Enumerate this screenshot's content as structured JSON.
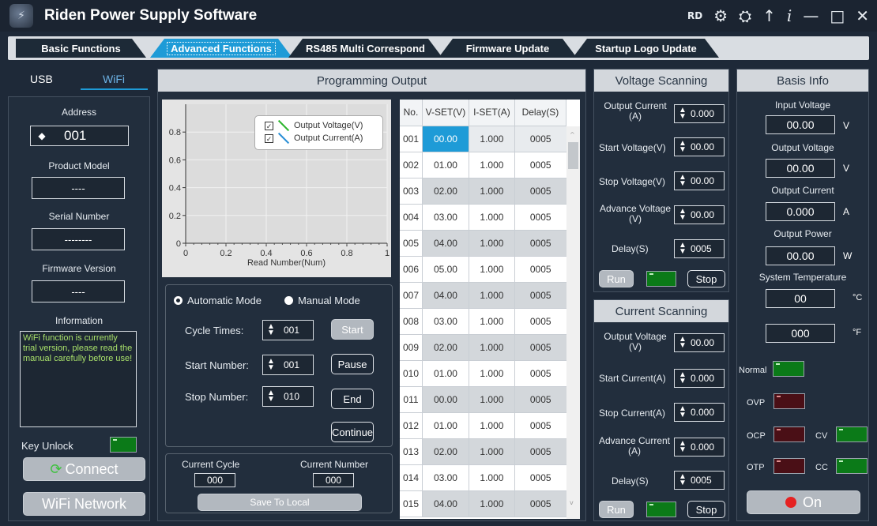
{
  "app": {
    "title": "Riden Power Supply Software",
    "rd": "RD"
  },
  "tabs": [
    "Basic Functions",
    "Advanced Functions",
    "RS485 Multi Correspond",
    "Firmware Update",
    "Startup Logo Update"
  ],
  "left": {
    "usb": "USB",
    "wifi": "WiFi",
    "address_label": "Address",
    "address": "001",
    "model_label": "Product Model",
    "model": "----",
    "serial_label": "Serial Number",
    "serial": "--------",
    "fw_label": "Firmware Version",
    "fw": "----",
    "info_label": "Information",
    "info": "WiFi function is currently trial version, please read the manual carefully before use!",
    "key_unlock": "Key Unlock",
    "connect": "Connect",
    "wifi_network": "WiFi Network"
  },
  "prog": {
    "title": "Programming Output",
    "legend_v": "Output Voltage(V)",
    "legend_c": "Output Current(A)",
    "auto": "Automatic Mode",
    "manual": "Manual Mode",
    "cycle_label": "Cycle Times:",
    "cycle": "001",
    "start_label": "Start Number:",
    "start": "001",
    "stop_label": "Stop Number:",
    "stop": "010",
    "btn_start": "Start",
    "btn_pause": "Pause",
    "btn_end": "End",
    "btn_continue": "Continue",
    "cur_cycle_label": "Current Cycle",
    "cur_cycle": "000",
    "cur_num_label": "Current Number",
    "cur_num": "000",
    "save": "Save To Local"
  },
  "chart_data": {
    "type": "line",
    "xlabel": "Read Number(Num)",
    "ylabel": "",
    "xlim": [
      0,
      1
    ],
    "ylim": [
      0,
      1
    ],
    "xticks": [
      "0",
      "0.2",
      "0.4",
      "0.6",
      "0.8",
      "1"
    ],
    "yticks": [
      "0",
      "0.2",
      "0.4",
      "0.6",
      "0.8"
    ],
    "series": [
      {
        "name": "Output Voltage(V)",
        "values": []
      },
      {
        "name": "Output Current(A)",
        "values": []
      }
    ],
    "grid": true,
    "legend": "top-right"
  },
  "table": {
    "headers": [
      "No.",
      "V-SET(V)",
      "I-SET(A)",
      "Delay(S)"
    ],
    "rows": [
      [
        "001",
        "00.00",
        "1.000",
        "0005"
      ],
      [
        "002",
        "01.00",
        "1.000",
        "0005"
      ],
      [
        "003",
        "02.00",
        "1.000",
        "0005"
      ],
      [
        "004",
        "03.00",
        "1.000",
        "0005"
      ],
      [
        "005",
        "04.00",
        "1.000",
        "0005"
      ],
      [
        "006",
        "05.00",
        "1.000",
        "0005"
      ],
      [
        "007",
        "04.00",
        "1.000",
        "0005"
      ],
      [
        "008",
        "03.00",
        "1.000",
        "0005"
      ],
      [
        "009",
        "02.00",
        "1.000",
        "0005"
      ],
      [
        "010",
        "01.00",
        "1.000",
        "0005"
      ],
      [
        "011",
        "00.00",
        "1.000",
        "0005"
      ],
      [
        "012",
        "01.00",
        "1.000",
        "0005"
      ],
      [
        "013",
        "02.00",
        "1.000",
        "0005"
      ],
      [
        "014",
        "03.00",
        "1.000",
        "0005"
      ],
      [
        "015",
        "04.00",
        "1.000",
        "0005"
      ]
    ]
  },
  "vscan": {
    "title": "Voltage Scanning",
    "oc_label": "Output Current (A)",
    "oc": "0.000",
    "sv_label": "Start Voltage(V)",
    "sv": "00.00",
    "stv_label": "Stop Voltage(V)",
    "stv": "00.00",
    "av_label": "Advance Voltage (V)",
    "av": "00.00",
    "d_label": "Delay(S)",
    "d": "0005",
    "run": "Run",
    "stop": "Stop"
  },
  "cscan": {
    "title": "Current Scanning",
    "ov_label": "Output Voltage (V)",
    "ov": "00.00",
    "sc_label": "Start Current(A)",
    "sc": "0.000",
    "stc_label": "Stop Current(A)",
    "stc": "0.000",
    "ac_label": "Advance Current (A)",
    "ac": "0.000",
    "d_label": "Delay(S)",
    "d": "0005",
    "run": "Run",
    "stop": "Stop"
  },
  "basis": {
    "title": "Basis Info",
    "in_v_label": "Input Voltage",
    "in_v": "00.00",
    "in_v_unit": "V",
    "out_v_label": "Output Voltage",
    "out_v": "00.00",
    "out_v_unit": "V",
    "out_c_label": "Output Current",
    "out_c": "0.000",
    "out_c_unit": "A",
    "out_p_label": "Output Power",
    "out_p": "00.00",
    "out_p_unit": "W",
    "temp_label": "System Temperature",
    "temp_c": "00",
    "temp_c_unit": "°C",
    "temp_f": "000",
    "temp_f_unit": "°F",
    "normal": "Normal",
    "ovp": "OVP",
    "ocp": "OCP",
    "otp": "OTP",
    "cv": "CV",
    "cc": "CC",
    "on": "On"
  }
}
